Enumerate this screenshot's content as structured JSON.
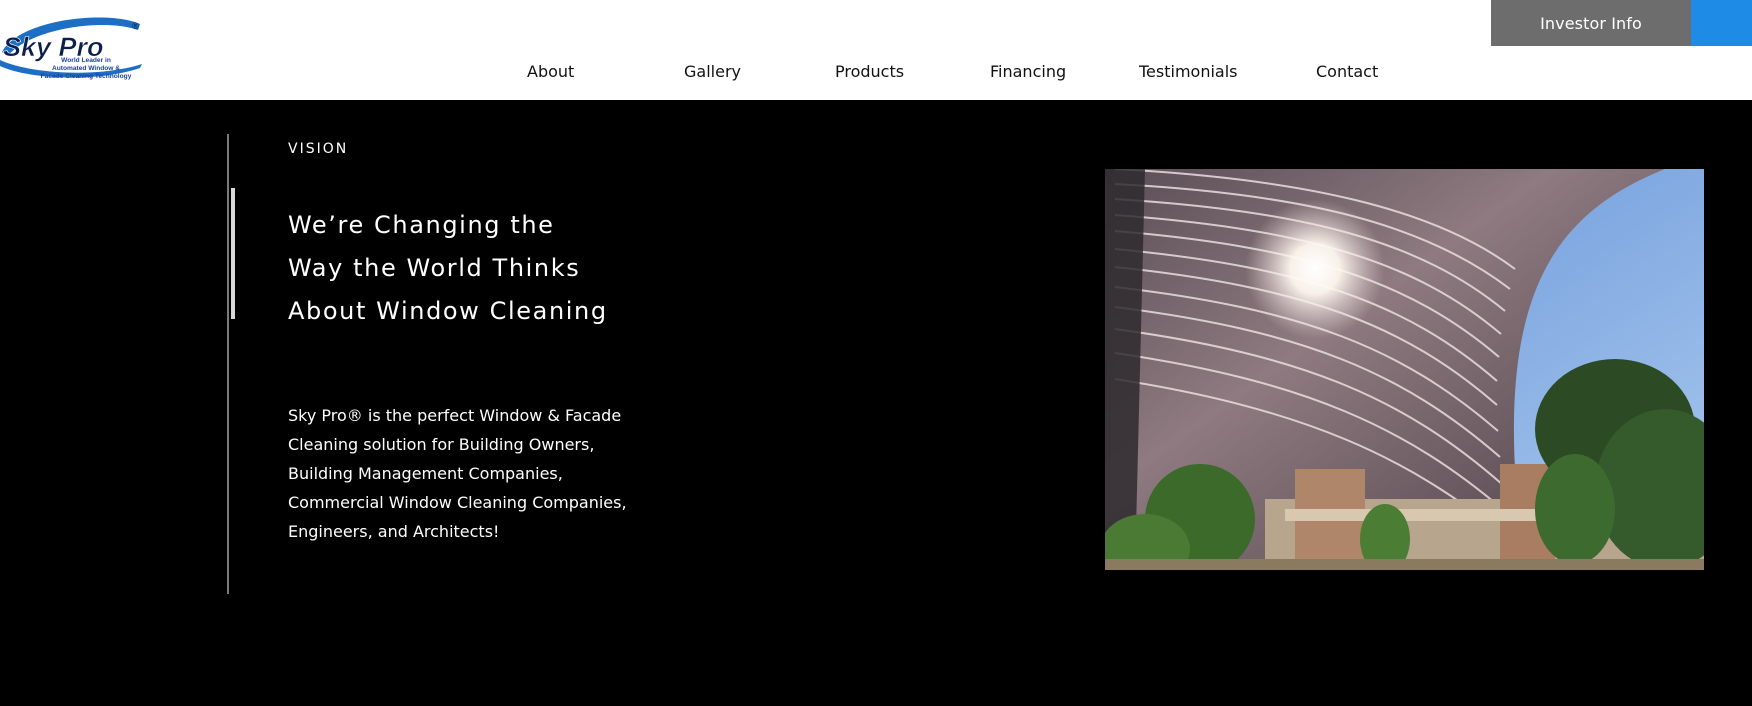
{
  "header": {
    "logo": {
      "brand": "Sky Pro",
      "registered": "®",
      "tagline": [
        "World Leader in",
        "Automated Window &",
        "Facade Cleaning Technology"
      ]
    },
    "investor_label": "Investor Info",
    "nav": [
      "About",
      "Gallery",
      "Products",
      "Financing",
      "Testimonials",
      "Contact"
    ]
  },
  "vision": {
    "eyebrow": "VISION",
    "headline": [
      "We’re Changing the",
      "Way the World Thinks",
      "About Window Cleaning"
    ],
    "body": "Sky Pro® is the perfect Window & Facade Cleaning solution for Building Owners, Building Management Companies, Commercial Window Cleaning Companies, Engineers, and Architects!"
  },
  "colors": {
    "investor_bg": "#6d6d6d",
    "accent_blue": "#1e8ce6",
    "page_bg": "#000000",
    "header_bg": "#ffffff"
  }
}
